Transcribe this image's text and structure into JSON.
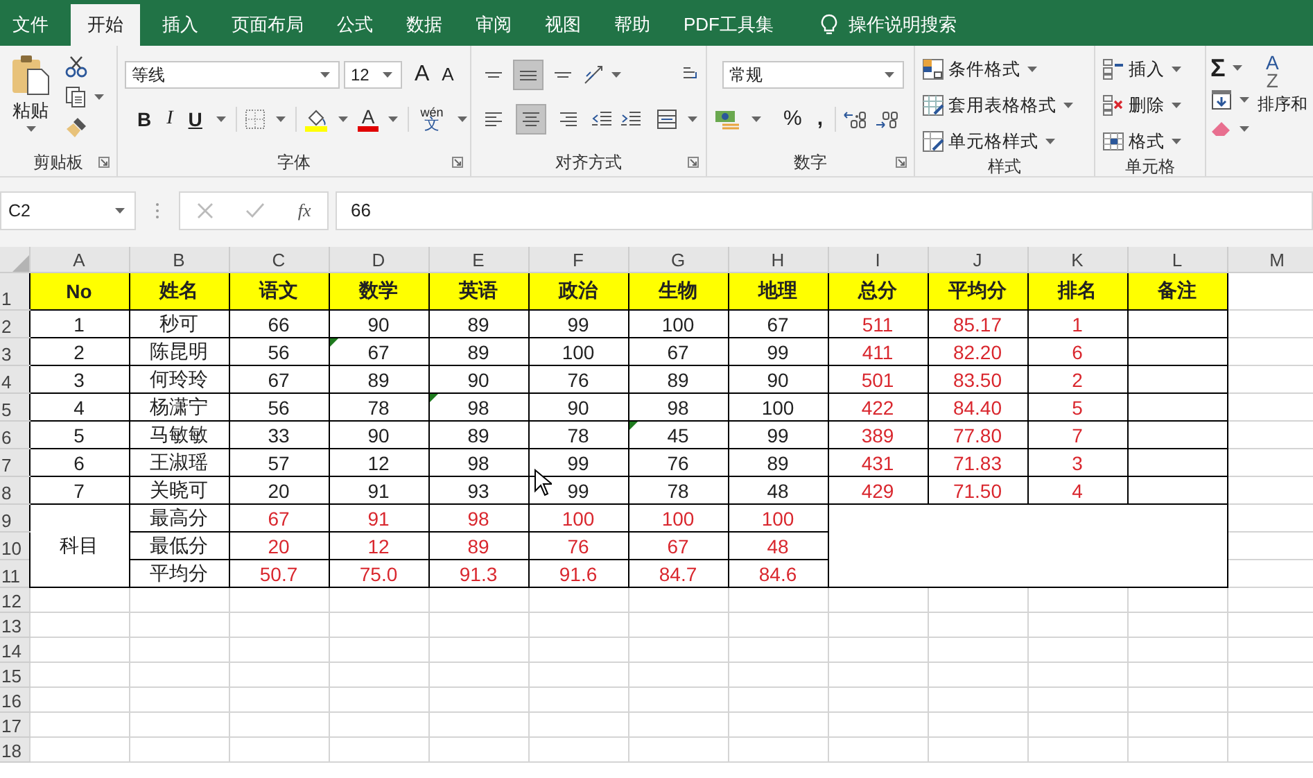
{
  "tabs": [
    {
      "label": "文件",
      "selected": false
    },
    {
      "label": "开始",
      "selected": true
    },
    {
      "label": "插入",
      "selected": false
    },
    {
      "label": "页面布局",
      "selected": false
    },
    {
      "label": "公式",
      "selected": false
    },
    {
      "label": "数据",
      "selected": false
    },
    {
      "label": "审阅",
      "selected": false
    },
    {
      "label": "视图",
      "selected": false
    },
    {
      "label": "帮助",
      "selected": false
    },
    {
      "label": "PDF工具集",
      "selected": false
    }
  ],
  "tell_me": {
    "text": "操作说明搜索"
  },
  "ribbon": {
    "clipboard": {
      "label": "剪贴板",
      "paste": "粘贴"
    },
    "font": {
      "label": "字体",
      "font_name": "等线",
      "font_size": "12",
      "grow": "A",
      "shrink": "A",
      "bold": "B",
      "italic": "I",
      "underline": "U",
      "font_color": "A",
      "phonetic_top": "wén",
      "phonetic_bottom": "文"
    },
    "alignment": {
      "label": "对齐方式",
      "vertical": [
        {
          "kind": "top",
          "selected": false
        },
        {
          "kind": "middle",
          "selected": true
        },
        {
          "kind": "bottom",
          "selected": false
        }
      ],
      "horizontal": [
        {
          "kind": "left",
          "selected": false
        },
        {
          "kind": "center",
          "selected": true
        },
        {
          "kind": "right",
          "selected": false
        }
      ]
    },
    "number": {
      "label": "数字",
      "format": "常规",
      "percent": "%",
      "comma": ","
    },
    "styles": {
      "label": "样式",
      "items": [
        {
          "label": "条件格式",
          "kind": "conditional"
        },
        {
          "label": "套用表格格式",
          "kind": "table"
        },
        {
          "label": "单元格样式",
          "kind": "cellstyle"
        }
      ]
    },
    "cells": {
      "label": "单元格",
      "items": [
        {
          "label": "插入",
          "kind": "insert"
        },
        {
          "label": "删除",
          "kind": "delete"
        },
        {
          "label": "格式",
          "kind": "format"
        }
      ]
    },
    "editing": {
      "sum": "Σ",
      "sort_top": "A",
      "sort_bottom": "Z",
      "sort": "排序和"
    }
  },
  "formula_bar": {
    "name_box": "C2",
    "fx": "fx",
    "formula": "66"
  },
  "sheet": {
    "columns": [
      "A",
      "B",
      "C",
      "D",
      "E",
      "F",
      "G",
      "H",
      "I",
      "J",
      "K",
      "L",
      "M"
    ],
    "row_numbers": [
      "1",
      "2",
      "3",
      "4",
      "5",
      "6",
      "7",
      "8",
      "9",
      "10",
      "11",
      "12",
      "13",
      "14",
      "15",
      "16",
      "17",
      "18"
    ],
    "headers": [
      "No",
      "姓名",
      "语文",
      "数学",
      "英语",
      "政治",
      "生物",
      "地理",
      "总分",
      "平均分",
      "排名",
      "备注"
    ],
    "students": [
      {
        "no": "1",
        "name": "秒可",
        "scores": [
          {
            "text": "66",
            "flagged": false
          },
          {
            "text": "90",
            "flagged": false
          },
          {
            "text": "89",
            "flagged": false
          },
          {
            "text": "99",
            "flagged": false
          },
          {
            "text": "100",
            "flagged": false
          },
          {
            "text": "67",
            "flagged": false
          }
        ],
        "total": "511",
        "average": "85.17",
        "rank": "1"
      },
      {
        "no": "2",
        "name": "陈昆明",
        "scores": [
          {
            "text": "56",
            "flagged": false
          },
          {
            "text": "67",
            "flagged": true
          },
          {
            "text": "89",
            "flagged": false
          },
          {
            "text": "100",
            "flagged": false
          },
          {
            "text": "67",
            "flagged": false
          },
          {
            "text": "99",
            "flagged": false
          }
        ],
        "total": "411",
        "average": "82.20",
        "rank": "6"
      },
      {
        "no": "3",
        "name": "何玲玲",
        "scores": [
          {
            "text": "67",
            "flagged": false
          },
          {
            "text": "89",
            "flagged": false
          },
          {
            "text": "90",
            "flagged": false
          },
          {
            "text": "76",
            "flagged": false
          },
          {
            "text": "89",
            "flagged": false
          },
          {
            "text": "90",
            "flagged": false
          }
        ],
        "total": "501",
        "average": "83.50",
        "rank": "2"
      },
      {
        "no": "4",
        "name": "杨潇宁",
        "scores": [
          {
            "text": "56",
            "flagged": false
          },
          {
            "text": "78",
            "flagged": false
          },
          {
            "text": "98",
            "flagged": true
          },
          {
            "text": "90",
            "flagged": false
          },
          {
            "text": "98",
            "flagged": false
          },
          {
            "text": "100",
            "flagged": false
          }
        ],
        "total": "422",
        "average": "84.40",
        "rank": "5"
      },
      {
        "no": "5",
        "name": "马敏敏",
        "scores": [
          {
            "text": "33",
            "flagged": false
          },
          {
            "text": "90",
            "flagged": false
          },
          {
            "text": "89",
            "flagged": false
          },
          {
            "text": "78",
            "flagged": false
          },
          {
            "text": "45",
            "flagged": true
          },
          {
            "text": "99",
            "flagged": false
          }
        ],
        "total": "389",
        "average": "77.80",
        "rank": "7"
      },
      {
        "no": "6",
        "name": "王淑瑶",
        "scores": [
          {
            "text": "57",
            "flagged": false
          },
          {
            "text": "12",
            "flagged": false
          },
          {
            "text": "98",
            "flagged": false
          },
          {
            "text": "99",
            "flagged": false
          },
          {
            "text": "76",
            "flagged": false
          },
          {
            "text": "89",
            "flagged": false
          }
        ],
        "total": "431",
        "average": "71.83",
        "rank": "3"
      },
      {
        "no": "7",
        "name": "关晓可",
        "scores": [
          {
            "text": "20",
            "flagged": false
          },
          {
            "text": "91",
            "flagged": false
          },
          {
            "text": "93",
            "flagged": false
          },
          {
            "text": "99",
            "flagged": false
          },
          {
            "text": "78",
            "flagged": false
          },
          {
            "text": "48",
            "flagged": false
          }
        ],
        "total": "429",
        "average": "71.50",
        "rank": "4"
      }
    ],
    "summary": {
      "label": "科目",
      "rows": [
        {
          "name": "最高分",
          "values": [
            "67",
            "91",
            "98",
            "100",
            "100",
            "100"
          ]
        },
        {
          "name": "最低分",
          "values": [
            "20",
            "12",
            "89",
            "76",
            "67",
            "48"
          ]
        },
        {
          "name": "平均分",
          "values": [
            "50.7",
            "75.0",
            "91.3",
            "91.6",
            "84.7",
            "84.6"
          ]
        }
      ]
    }
  }
}
